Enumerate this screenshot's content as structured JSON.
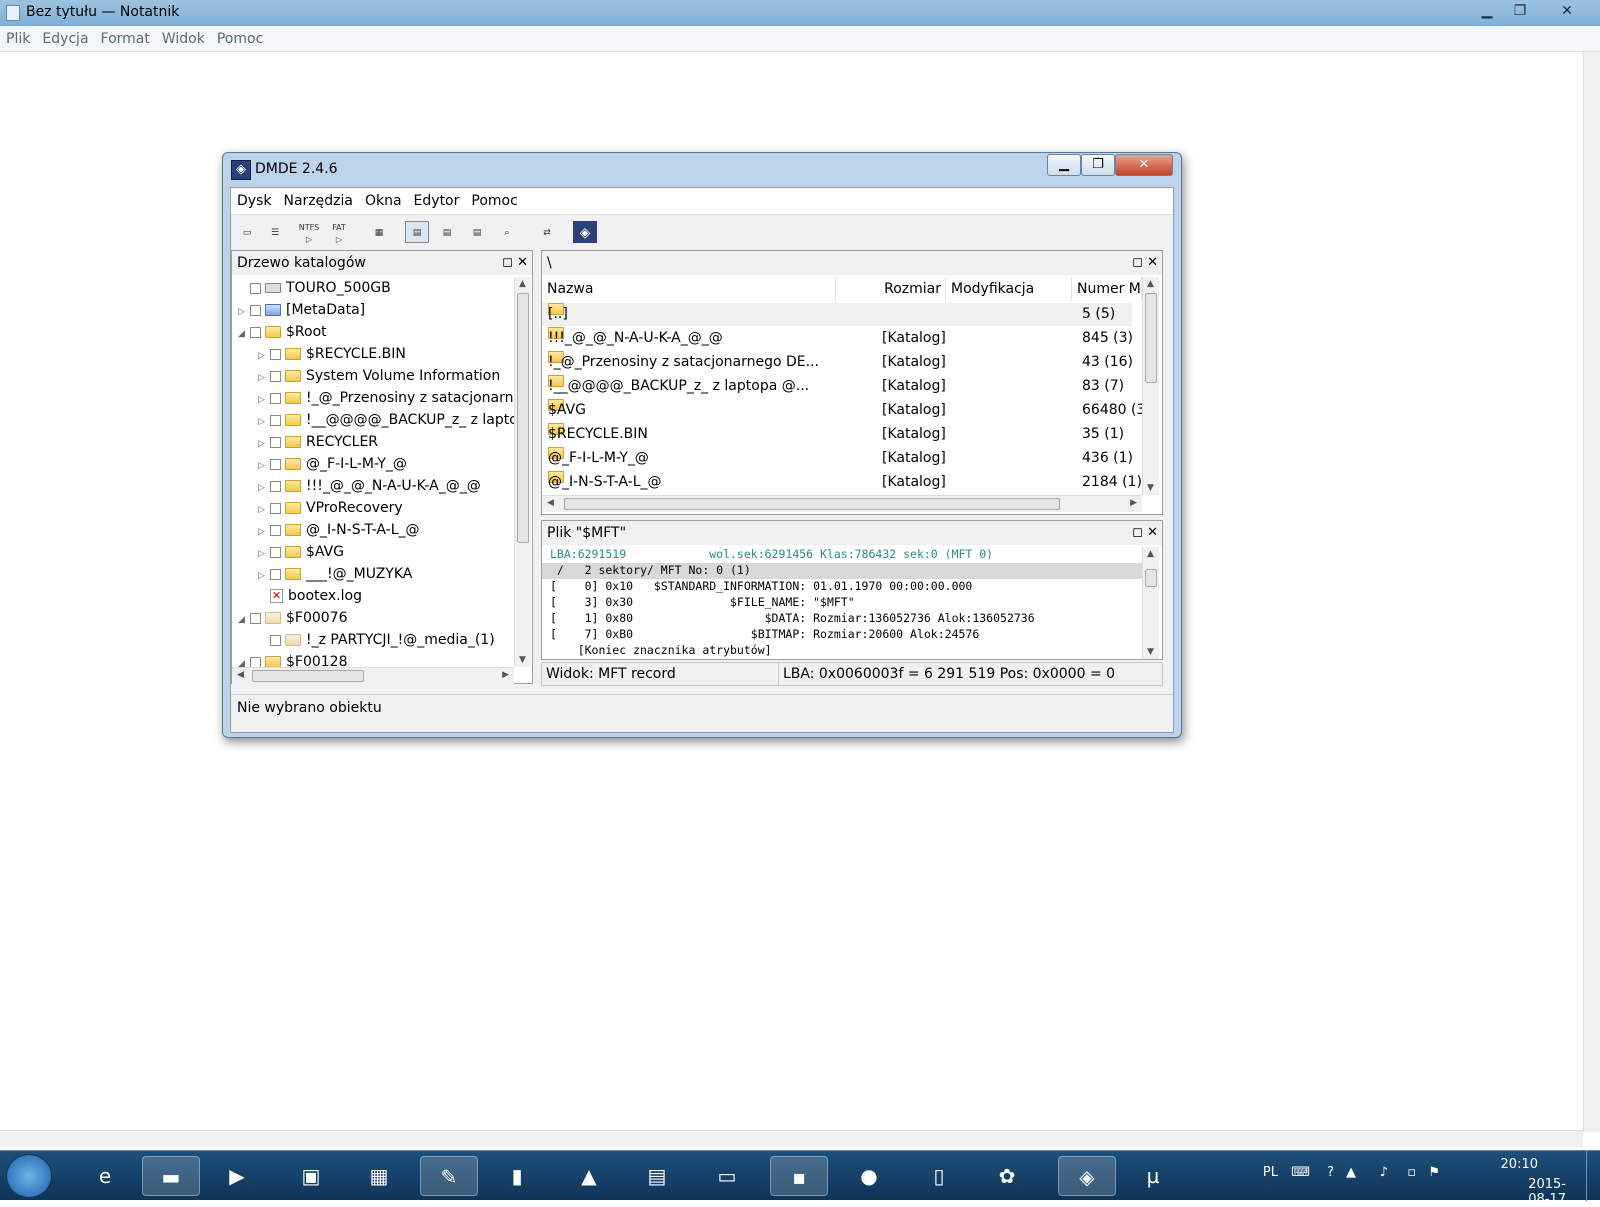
{
  "notepad": {
    "title": "Bez tytułu — Notatnik",
    "menu": [
      "Plik",
      "Edycja",
      "Format",
      "Widok",
      "Pomoc"
    ],
    "minimize_glyph": "▁",
    "maximize_glyph": "❐",
    "close_glyph": "✕"
  },
  "dmde": {
    "title": "DMDE 2.4.6",
    "logo_glyph": "◈",
    "menu": [
      "Dysk",
      "Narzędzia",
      "Okna",
      "Edytor",
      "Pomoc"
    ],
    "toolbar": {
      "ntfs_label": "NTFS",
      "fat_label": "FAT"
    },
    "tree": {
      "title": "Drzewo katalogów",
      "items": [
        {
          "label": "TOURO_500GB",
          "expander": ""
        },
        {
          "label": "[MetaData]",
          "expander": "▷"
        },
        {
          "label": "$Root",
          "expander": "◢"
        },
        {
          "label": "$RECYCLE.BIN",
          "expander": "▷"
        },
        {
          "label": "System Volume Information",
          "expander": "▷"
        },
        {
          "label": "!_@_Przenosiny z satacjonarnego",
          "expander": "▷"
        },
        {
          "label": "!__@@@@_BACKUP_z_ z laptop",
          "expander": "▷"
        },
        {
          "label": "RECYCLER",
          "expander": "▷"
        },
        {
          "label": "@_F-I-L-M-Y_@",
          "expander": "▷"
        },
        {
          "label": "!!!_@_@_N-A-U-K-A_@_@",
          "expander": "▷"
        },
        {
          "label": "VProRecovery",
          "expander": "▷"
        },
        {
          "label": "@_I-N-S-T-A-L_@",
          "expander": "▷"
        },
        {
          "label": "$AVG",
          "expander": "▷"
        },
        {
          "label": "___!@_MUZYKA",
          "expander": "▷"
        },
        {
          "label": "bootex.log",
          "expander": ""
        },
        {
          "label": "$F00076",
          "expander": "◢"
        },
        {
          "label": "!_z PARTYCJI_!@_media_(1)",
          "expander": ""
        },
        {
          "label": "$F00128",
          "expander": "◢"
        }
      ]
    },
    "list": {
      "path": "\\",
      "columns": [
        "Nazwa",
        "Rozmiar",
        "Modyfikacja",
        "Numer M"
      ],
      "rows": [
        {
          "name": "[..]",
          "size": "",
          "mod": "",
          "num": "5 (5)"
        },
        {
          "name": "!!!_@_@_N-A-U-K-A_@_@",
          "size": "[Katalog]",
          "mod": "",
          "num": "845 (3)"
        },
        {
          "name": "!_@_Przenosiny z satacjonarnego DE...",
          "size": "[Katalog]",
          "mod": "",
          "num": "43 (16)"
        },
        {
          "name": "!__@@@@_BACKUP_z_ z laptopa @...",
          "size": "[Katalog]",
          "mod": "",
          "num": "83 (7)"
        },
        {
          "name": "$AVG",
          "size": "[Katalog]",
          "mod": "",
          "num": "66480 (3"
        },
        {
          "name": "$RECYCLE.BIN",
          "size": "[Katalog]",
          "mod": "",
          "num": "35 (1)"
        },
        {
          "name": "@_F-I-L-M-Y_@",
          "size": "[Katalog]",
          "mod": "",
          "num": "436 (1)"
        },
        {
          "name": "@_I-N-S-T-A-L_@",
          "size": "[Katalog]",
          "mod": "",
          "num": "2184 (1)"
        }
      ]
    },
    "mft": {
      "title": "Plik \"$MFT\"",
      "line_header": "LBA:6291519            wol.sek:6291456 Klas:786432 sek:0 (MFT 0)",
      "line_sel": " /   2 sektory/ MFT No: 0 (1)",
      "lines": [
        "[    0] 0x10   $STANDARD_INFORMATION: 01.01.1970 00:00:00.000",
        "[    3] 0x30              $FILE_NAME: \"$MFT\"",
        "[    1] 0x80                   $DATA: Rozmiar:136052736 Alok:136052736",
        "[    7] 0xB0                 $BITMAP: Rozmiar:20600 Alok:24576",
        "    [Koniec znacznika atrybutów]"
      ],
      "status_view": "Widok: MFT record",
      "status_lba": "LBA: 0x0060003f = 6 291 519  Pos: 0x0000 = 0"
    },
    "statusbar": "Nie wybrano obiektu"
  },
  "taskbar": {
    "lang": "PL",
    "time": "20:10",
    "date": "2015-08-17",
    "apps": [
      "ie-icon",
      "explorer-icon",
      "media-player-icon",
      "remote-desktop-icon",
      "calculator-icon",
      "notepad-icon",
      "office-icon",
      "vlc-icon",
      "winrar-icon",
      "monitor-icon",
      "floppy-icon",
      "firefox-icon",
      "folder-window-icon",
      "paint-icon",
      "dmde-icon",
      "utorrent-icon"
    ]
  }
}
